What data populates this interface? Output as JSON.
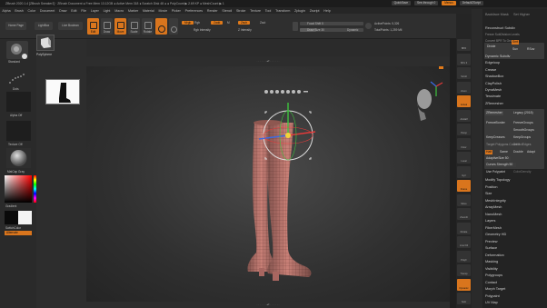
{
  "titlebar": {
    "title": "ZBrush 2020.1.4 [ZBrush Sneaker2] · ZBrush Document   ● Free Mem 13.12GB ● Active Mem 318 ● Scratch Disk 48 ● ● PolyCount ▶ 2.69 KP ● MeshCount ▶ 1",
    "quicksave": "QuickSave",
    "seethrough": "See-through 0",
    "menus_btn": "Menus",
    "default_script": "DefaultZScript"
  },
  "menubar": [
    "Alpha",
    "Brush",
    "Color",
    "Document",
    "Draw",
    "Edit",
    "File",
    "Layer",
    "Light",
    "Macro",
    "Marker",
    "Material",
    "Movie",
    "Picker",
    "Preferences",
    "Render",
    "Stencil",
    "Stroke",
    "Texture",
    "Tool",
    "Transform",
    "Zplugin",
    "Zscript",
    "Help"
  ],
  "toolbar": {
    "home_page": "Home Page",
    "lightbox": "LightBox",
    "live_boolean": "Live Boolean",
    "edit": "Edit",
    "draw": "Draw",
    "move": "Move",
    "scale": "Scale",
    "rotate": "Rotate",
    "mrgb": "Mrgb",
    "rgb": "Rgb",
    "m": "M",
    "rgb_intensity": "Rgb Intensity",
    "zadd": "Zadd",
    "zsub": "Zsub",
    "zcut": "Zcut",
    "z_intensity": "Z Intensity",
    "focal_shift": "Focal Shift 0",
    "draw_size": "Draw Size 30",
    "dynamic": "Dynamic",
    "active_points": "ActivePoints: 5,326",
    "total_points": "TotalPoints: 1,259 Mil"
  },
  "left": {
    "brush_label": "Standard",
    "stroke_label": "Dots",
    "alpha_label": "Alpha Off",
    "texture_label": "Texture Off",
    "material_label": "MatCap Gray",
    "gradient_label": "Gradient",
    "switch_label": "SwitchColor",
    "alternate_label": "Alternate",
    "polysphere_label": "PolySphere"
  },
  "viewport": {
    "top_hint": "· · · · · · ▴▾ · · · · · ·",
    "bottom_hint": "· · · · · · ▴▾ · · · · · ·"
  },
  "shelf": [
    "BPR",
    "SPix 3",
    "Scroll",
    "Zoom",
    "Actual",
    "AAHalf",
    "Persp",
    "Floor",
    "Local",
    "Gyz",
    "Frame",
    "Move",
    "ZoomD",
    "Rotate",
    "Line Fill",
    "PolyF",
    "Transp",
    "Dynamic",
    "Solo"
  ],
  "tray": {
    "top_items": [
      "Backface Mask",
      "Set Higher",
      "Reconstruct Subdiv",
      "Freeze SubDivision Levels",
      "Convert BPR To Geo"
    ],
    "divide_label": "Divide",
    "smt": "Smt",
    "suv": "Suv",
    "rsuv": "RSuv",
    "sections": [
      "Dynamic Subdiv",
      "Edgeloop",
      "Crease",
      "ShadowBox",
      "ClayPolish",
      "DynaMesh",
      "Tessimate",
      "ZRemesher"
    ],
    "zremesher_btn": "ZRemesher",
    "legacy": "Legacy (2018)",
    "freeze_border": "FreezeBorder",
    "freeze_groups": "FreezeGroups",
    "smooth_groups": "SmoothGroups",
    "keep_groups": "KeepGroups",
    "keep_creases": "KeepCreases",
    "detect_edges": "DetectEdges",
    "target_polycount": "Target Polygons Count 5",
    "half": "Half",
    "same": "Same",
    "double": "Double",
    "adapt": "Adapt",
    "adaptive_size": "AdaptiveSize 50",
    "curves_strength": "Curves Strength 50",
    "use_polypaint": "Use Polypaint",
    "color_density": "ColorDensity",
    "lower": [
      "Modify Topology",
      "Position",
      "Size",
      "MeshIntegrity",
      "ArrayMesh",
      "NanoMesh",
      "Layers",
      "FiberMesh",
      "Geometry HD",
      "Preview",
      "Surface",
      "Deformation",
      "Masking",
      "Visibility",
      "Polygroups",
      "Contact",
      "Morph Target",
      "Polypaint",
      "UV Map"
    ]
  },
  "colors": {
    "accent": "#d9751d",
    "bg": "#2b2b2b",
    "boot": "#c87f78",
    "gizmo_red": "#e23a3a",
    "gizmo_green": "#3ec43e",
    "gizmo_blue": "#3a6ae2"
  }
}
